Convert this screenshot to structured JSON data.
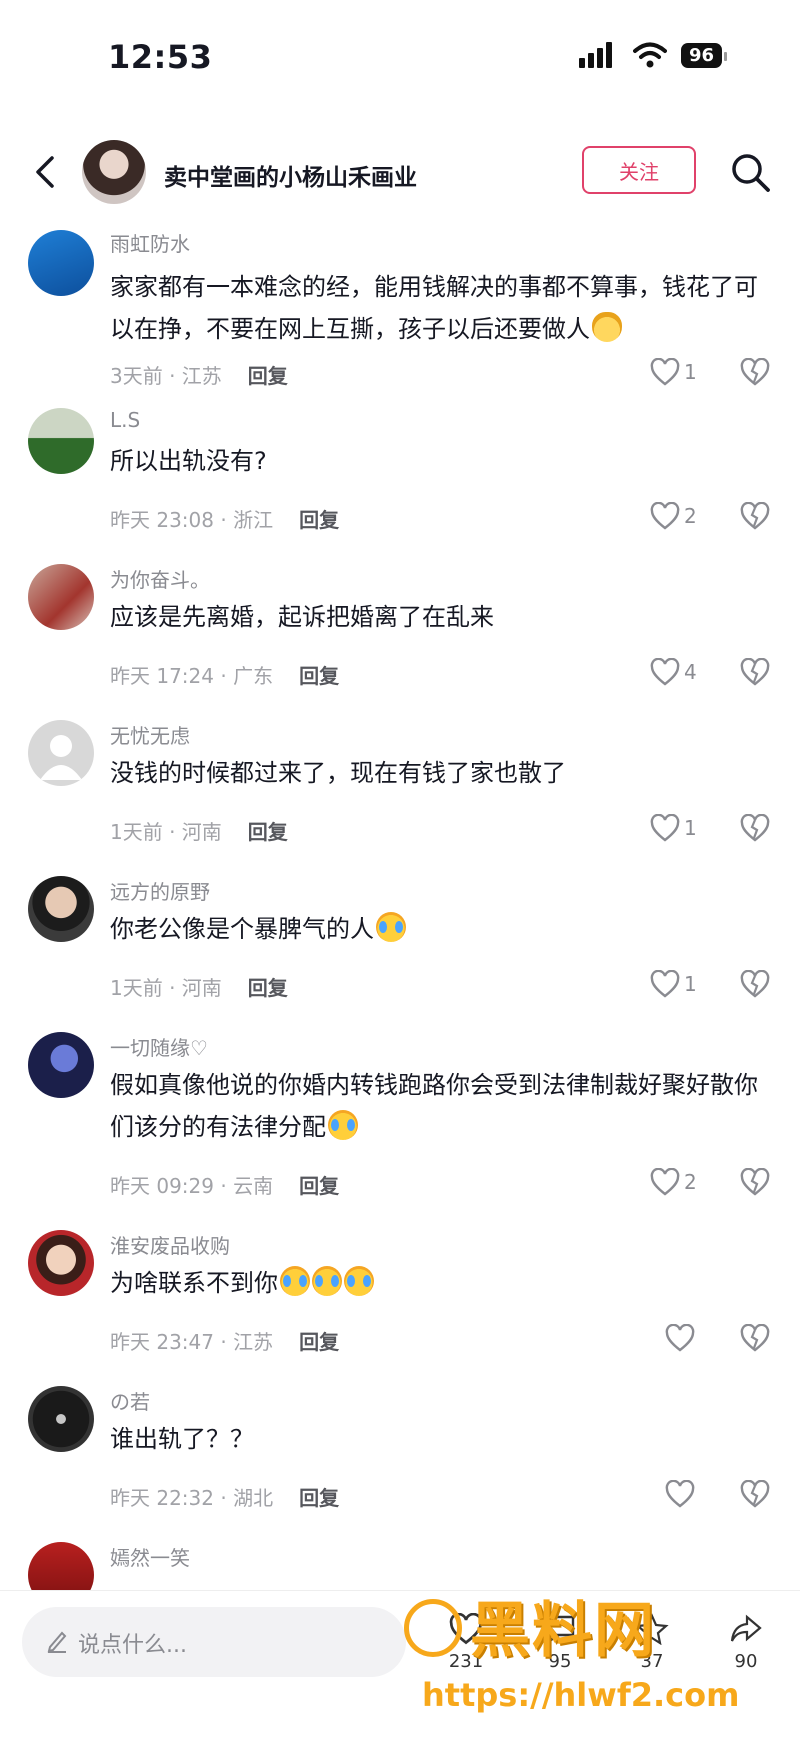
{
  "status": {
    "time": "12:53",
    "battery": "96"
  },
  "header": {
    "title": "卖中堂画的小杨山禾画业",
    "follow_label": "关注"
  },
  "comments": [
    {
      "name": "雨虹防水",
      "text": "家家都有一本难念的经，能用钱解决的事都不算事，钱花了可以在挣，不要在网上互撕，孩子以后还要做人",
      "time": "3天前 · 江苏",
      "reply": "回复",
      "likes": "1"
    },
    {
      "name": "L.S",
      "text": "所以出轨没有?",
      "time": "昨天 23:08 · 浙江",
      "reply": "回复",
      "likes": "2"
    },
    {
      "name": "为你奋斗。",
      "text": "应该是先离婚，起诉把婚离了在乱来",
      "time": "昨天 17:24 · 广东",
      "reply": "回复",
      "likes": "4"
    },
    {
      "name": "无忧无虑",
      "text": "没钱的时候都过来了，现在有钱了家也散了",
      "time": "1天前 · 河南",
      "reply": "回复",
      "likes": "1"
    },
    {
      "name": "远方的原野",
      "text": "你老公像是个暴脾气的人",
      "time": "1天前 · 河南",
      "reply": "回复",
      "likes": "1"
    },
    {
      "name": "一切随缘♡",
      "text": "假如真像他说的你婚内转钱跑路你会受到法律制裁好聚好散你们该分的有法律分配",
      "time": "昨天 09:29 · 云南",
      "reply": "回复",
      "likes": "2"
    },
    {
      "name": "淮安废品收购",
      "text": "为啥联系不到你",
      "time": "昨天 23:47 · 江苏",
      "reply": "回复",
      "likes": ""
    },
    {
      "name": "の若",
      "text": "谁出轨了？？",
      "time": "昨天 22:32 · 湖北",
      "reply": "回复",
      "likes": ""
    },
    {
      "name": "嫣然一笑",
      "text": "",
      "time": "",
      "reply": "",
      "likes": ""
    }
  ],
  "bottom": {
    "input_placeholder": "说点什么...",
    "counts": [
      "231",
      "95",
      "37",
      "90"
    ]
  },
  "watermark": {
    "logo": "黑料网",
    "url": "https://hlwf2.com"
  },
  "colors": {
    "accent": "#e0416a",
    "watermark": "#f7a81b"
  }
}
